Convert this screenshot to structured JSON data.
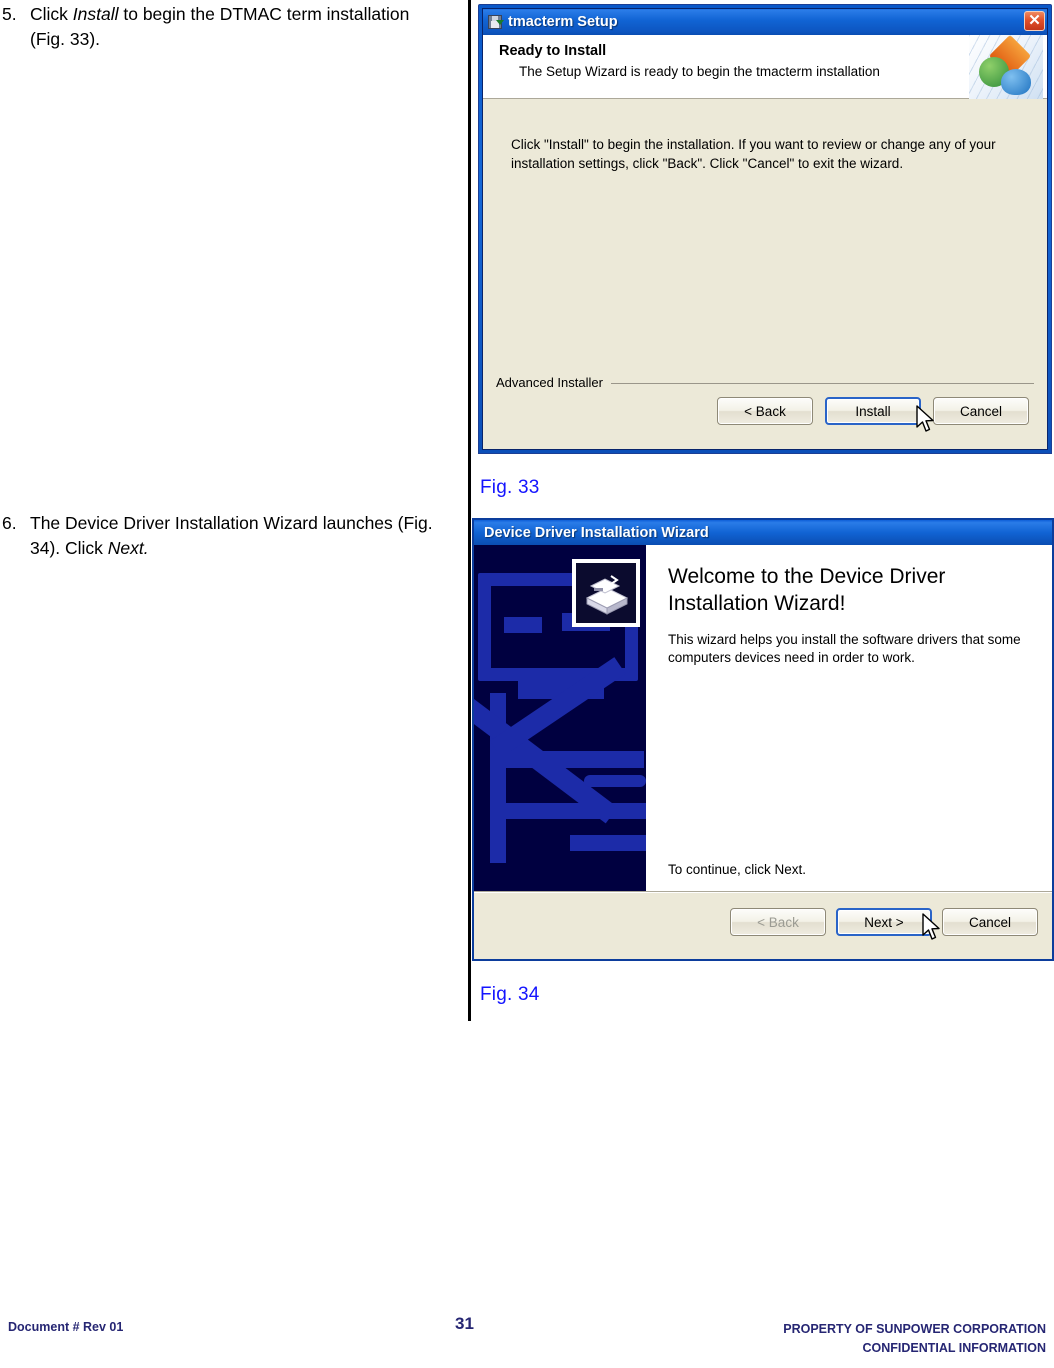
{
  "steps": [
    {
      "number": "5.",
      "segments": [
        {
          "text": "Click ",
          "italic": false
        },
        {
          "text": "Install",
          "italic": true
        },
        {
          "text": " to begin the DTMAC term installation (Fig. 33).",
          "italic": false
        }
      ]
    },
    {
      "number": "6.",
      "segments": [
        {
          "text": "The Device Driver Installation Wizard launches (Fig. 34). Click ",
          "italic": false
        },
        {
          "text": "Next.",
          "italic": true
        }
      ]
    }
  ],
  "figures": {
    "fig33_caption": "Fig. 33",
    "fig34_caption": "Fig. 34",
    "caption_color": "#1414ff"
  },
  "tmacterm_dialog": {
    "title": "tmacterm Setup",
    "title_icon": "installer-disk-icon",
    "close_label": "✕",
    "header_title": "Ready to Install",
    "header_subtitle": "The Setup Wizard is ready to begin the tmacterm installation",
    "body_text": "Click \"Install\" to begin the installation.  If you want to review or change any of your installation settings, click \"Back\".  Click \"Cancel\" to exit the wizard.",
    "branding": "Advanced Installer",
    "buttons": [
      {
        "label": "< Back",
        "default": false,
        "disabled": false
      },
      {
        "label": "Install",
        "default": true,
        "disabled": false
      },
      {
        "label": "Cancel",
        "default": false,
        "disabled": false
      }
    ],
    "titlebar_color": "#1164d4",
    "face_color": "#ece9d8"
  },
  "ddiw_dialog": {
    "title": "Device Driver Installation Wizard",
    "welcome_line1": "Welcome to the Device Driver",
    "welcome_line2": "Installation Wizard!",
    "paragraph": "This wizard helps you install the software drivers that some computers devices need in order to work.",
    "continue_text": "To continue, click Next.",
    "buttons": [
      {
        "label": "< Back",
        "default": false,
        "disabled": true
      },
      {
        "label": "Next >",
        "default": true,
        "disabled": false
      },
      {
        "label": "Cancel",
        "default": false,
        "disabled": false
      }
    ],
    "sidebar_color": "#000040",
    "sidebar_graphic_color": "#1c2ba8"
  },
  "page_footer": {
    "left": "Document #  Rev 01",
    "page_number": "31",
    "right_line1": "PROPERTY OF SUNPOWER CORPORATION",
    "right_line2": "CONFIDENTIAL INFORMATION",
    "text_color": "#262673"
  }
}
